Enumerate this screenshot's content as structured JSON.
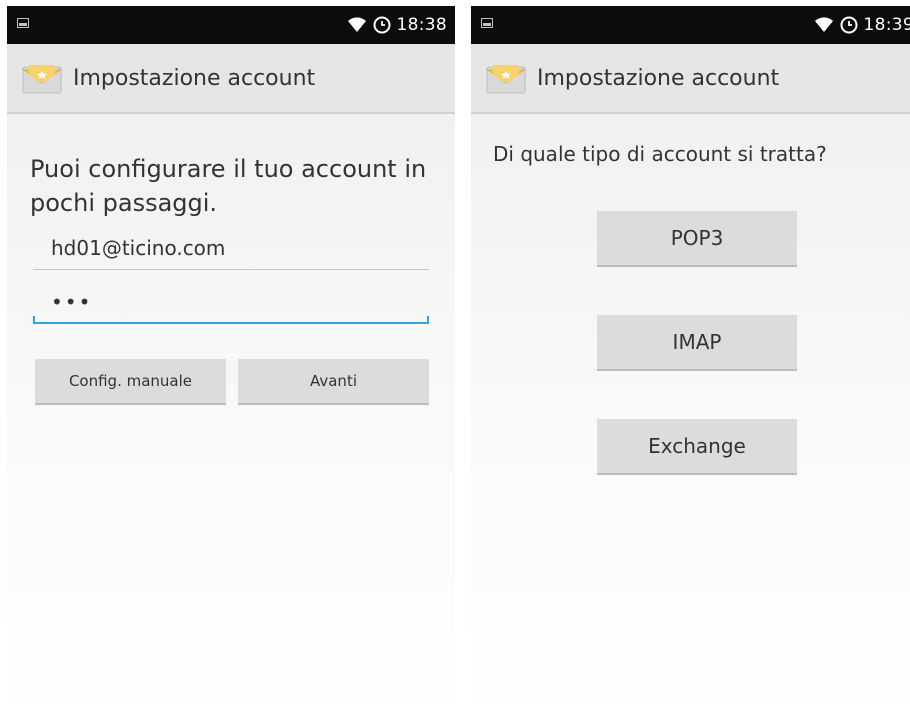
{
  "left_screen": {
    "status_bar": {
      "time": "18:38"
    },
    "action_bar": {
      "title": "Impostazione account",
      "icon": "email-envelope-icon"
    },
    "heading": "Puoi configurare il tuo account in pochi passaggi.",
    "email_field": {
      "value": "hd01@ticino.com"
    },
    "password_field": {
      "value": "•••"
    },
    "buttons": {
      "manual": "Config. manuale",
      "next": "Avanti"
    }
  },
  "right_screen": {
    "status_bar": {
      "time": "18:39"
    },
    "action_bar": {
      "title": "Impostazione account",
      "icon": "email-envelope-icon"
    },
    "question": "Di quale tipo di account si tratta?",
    "account_types": [
      "POP3",
      "IMAP",
      "Exchange"
    ]
  },
  "colors": {
    "status_bar": "#0c0c0c",
    "action_bar": "#e6e6e6",
    "accent_underline": "#33a5d8",
    "button": "#dcdcdc",
    "text": "#333333"
  }
}
